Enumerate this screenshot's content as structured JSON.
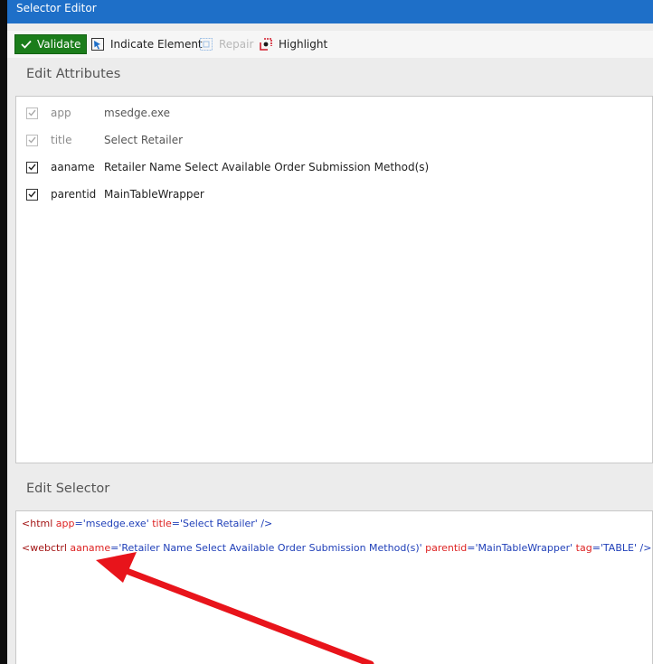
{
  "window": {
    "title": "Selector Editor"
  },
  "toolbar": {
    "validate_label": "Validate",
    "indicate_label": "Indicate Element",
    "repair_label": "Repair",
    "highlight_label": "Highlight"
  },
  "edit_attributes": {
    "title": "Edit Attributes",
    "rows": [
      {
        "checked": true,
        "enabled": false,
        "name": "app",
        "value": "msedge.exe"
      },
      {
        "checked": true,
        "enabled": false,
        "name": "title",
        "value": "Select Retailer"
      },
      {
        "checked": true,
        "enabled": true,
        "name": "aaname",
        "value": "Retailer Name Select Available Order Submission Method(s)"
      },
      {
        "checked": true,
        "enabled": true,
        "name": "parentid",
        "value": "MainTableWrapper"
      }
    ]
  },
  "edit_selector": {
    "title": "Edit Selector",
    "line1": {
      "open": "<html",
      "a1n": "app",
      "a1v": "'msedge.exe'",
      "a2n": "title",
      "a2v": "'Select Retailer'",
      "close": "/>"
    },
    "line2": {
      "open": "<webctrl",
      "a1n": "aaname",
      "a1v": "'Retailer Name Select Available Order Submission Method(s)'",
      "a2n": "parentid",
      "a2v": "'MainTableWrapper'",
      "a3n": "tag",
      "a3v": "'TABLE'",
      "close": "/>"
    }
  },
  "annotation": {
    "arrow_color": "#e8141b"
  }
}
